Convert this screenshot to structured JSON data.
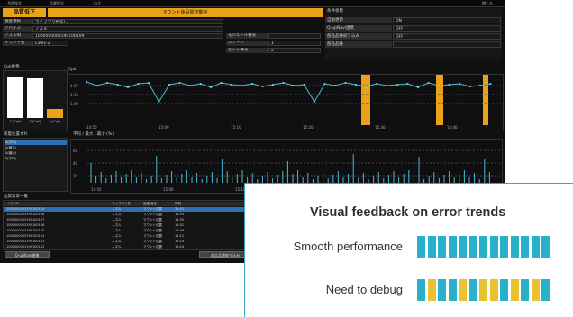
{
  "colors": {
    "accent": "#e8a31a",
    "teal": "#2ab0c8",
    "yellow": "#e8c233",
    "line": "#3aa6c2"
  },
  "menu": [
    "予防保全",
    "品質保全",
    "ログ",
    "閉じる"
  ],
  "header": {
    "status": "品質低下",
    "message": "マウント後品質変動中"
  },
  "info": {
    "rows": [
      {
        "label": "検査項目",
        "value": "ライブラリ名なし"
      },
      {
        "label": "デバイス",
        "value": "ノズル"
      },
      {
        "label": "ノズルID",
        "value": "1000000003190100109",
        "label2": "モジュール番号",
        "value2": ""
      },
      {
        "label": "マウント名",
        "value": "Line1-2",
        "label2": "ステージ",
        "value2": "1",
        "label3": "ピット番号",
        "value3": "2"
      }
    ]
  },
  "conditions": {
    "title": "条件状態",
    "rows": [
      {
        "label": "自動更新",
        "value": "ON"
      },
      {
        "label": "Q-upNavi連携",
        "value": "OFF"
      },
      {
        "label": "部品品番絞り込み",
        "value": "OFF"
      },
      {
        "label": "部品品番",
        "value": ""
      }
    ]
  },
  "cpk": {
    "label": "Cpk推移",
    "bars": [
      0.95,
      0.92,
      0.2
    ],
    "bar_labels": [
      "X (Cpk)",
      "Y (Cpk)",
      "θ (Cpk)"
    ],
    "trend_label": "Cpk",
    "yticks": [
      "1.67",
      "1.33",
      "1.00"
    ],
    "xticks": [
      "14:50",
      "15:00",
      "15:10",
      "15:20",
      "15:30",
      "15:40"
    ]
  },
  "deviation": {
    "label": "吸着位置ずれ",
    "chart_label": "平均 / 最大 / 最小 (%)",
    "list": [
      "X(平均)",
      "X(最大)",
      "X(最小)",
      "Y(平均)"
    ],
    "yticks": [
      "60",
      "40",
      "20"
    ],
    "xticks": [
      "14:50",
      "15:00",
      "15:10",
      "15:20",
      "15:30",
      "15:40"
    ]
  },
  "table": {
    "label": "品質異常一覧",
    "headers": [
      "ノズルID",
      "ライブラリ名",
      "品番/品名",
      "時刻"
    ],
    "rows": [
      [
        "1000000003190100109",
        "ノズル",
        "マウント位置",
        "14:51"
      ],
      [
        "1000000003190100108",
        "ノズル",
        "マウント位置",
        "14:53"
      ],
      [
        "1000000003190100107",
        "ノズル",
        "マウント位置",
        "14:55"
      ],
      [
        "1000000003190100106",
        "ノズル",
        "マウント位置",
        "15:02"
      ],
      [
        "1000000003190100105",
        "ノズル",
        "マウント位置",
        "15:06"
      ],
      [
        "1000000003190100104",
        "ノズル",
        "マウント位置",
        "15:12"
      ],
      [
        "1000000003190100103",
        "ノズル",
        "マウント位置",
        "15:19"
      ],
      [
        "1000000003190100102",
        "ノズル",
        "マウント位置",
        "15:24"
      ]
    ],
    "buttons": [
      "Q-upNavi連携",
      "部品品番絞り込み"
    ]
  },
  "overlay": {
    "title": "Visual feedback on error trends",
    "rows": [
      {
        "label": "Smooth performance",
        "pattern": [
          "t",
          "t",
          "t",
          "t",
          "t",
          "t",
          "t",
          "t",
          "t",
          "t",
          "t",
          "t",
          "t"
        ]
      },
      {
        "label": "Need to debug",
        "pattern": [
          "t",
          "y",
          "t",
          "t",
          "y",
          "t",
          "y",
          "y",
          "t",
          "y",
          "t",
          "y",
          "t"
        ]
      }
    ]
  }
}
